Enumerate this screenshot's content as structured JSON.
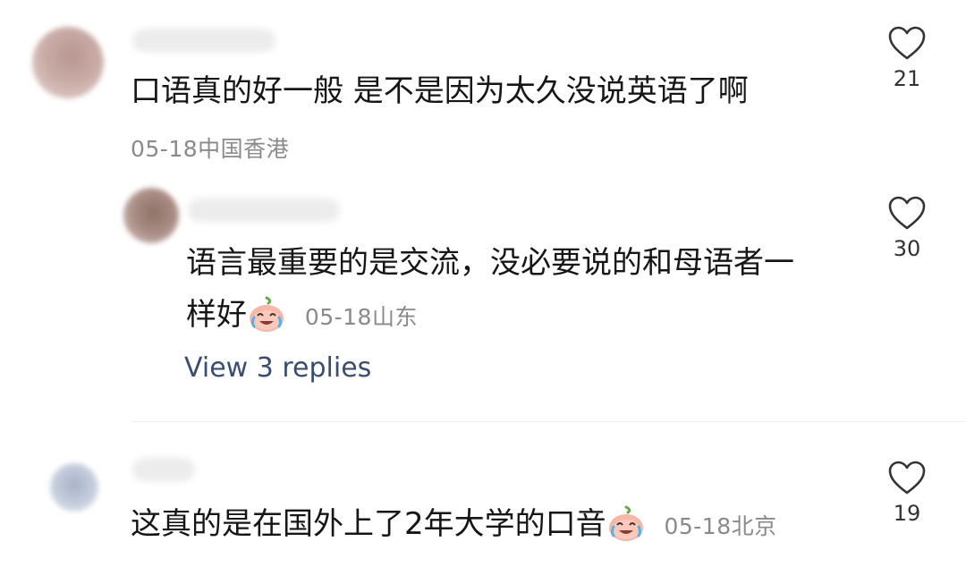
{
  "comments": [
    {
      "text": "口语真的好一般 是不是因为太久没说英语了啊",
      "date": "05-18",
      "region": "中国香港",
      "likes": "21"
    },
    {
      "text_line1": "语言最重要的是交流，没必要说的和母语者一",
      "text_line2": "样好",
      "emoji": "crying-laughing-peach-icon",
      "date": "05-18",
      "region": "山东",
      "likes": "30"
    },
    {
      "text": "这真的是在国外上了2年大学的口音",
      "emoji": "crying-laughing-peach-icon",
      "date": "05-18",
      "region": "北京",
      "likes": "19"
    }
  ],
  "view_replies": "View 3 replies",
  "colors": {
    "meta": "#8a8a8a",
    "link": "#3b4d6f",
    "divider": "#ededed"
  }
}
